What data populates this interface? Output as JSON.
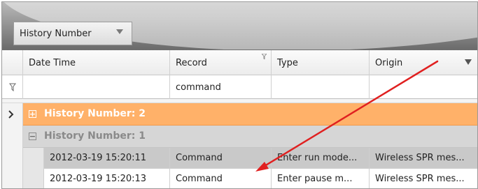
{
  "grouping": {
    "chip_label": "History Number"
  },
  "columns": [
    {
      "label": "Date Time"
    },
    {
      "label": "Record"
    },
    {
      "label": "Type"
    },
    {
      "label": "Origin"
    }
  ],
  "filter": {
    "record_value": "command"
  },
  "groups": [
    {
      "title": "History Number: 2",
      "expander": "+"
    },
    {
      "title": "History Number: 1",
      "expander": "−"
    }
  ],
  "rows": [
    {
      "date_time": "2012-03-19 15:20:11",
      "record": "Command",
      "type": "Enter run mode...",
      "origin": "Wireless SPR mes..."
    },
    {
      "date_time": "2012-03-19 15:20:13",
      "record": "Command",
      "type": "Enter pause m...",
      "origin": "Wireless SPR mes..."
    }
  ],
  "colors": {
    "group_highlight": "#ffb169",
    "annotation_arrow": "#e02020"
  },
  "icons": {
    "row_selector": "chevron-right-icon",
    "filter": "filter-icon",
    "dropdown": "triangle-down-icon"
  }
}
